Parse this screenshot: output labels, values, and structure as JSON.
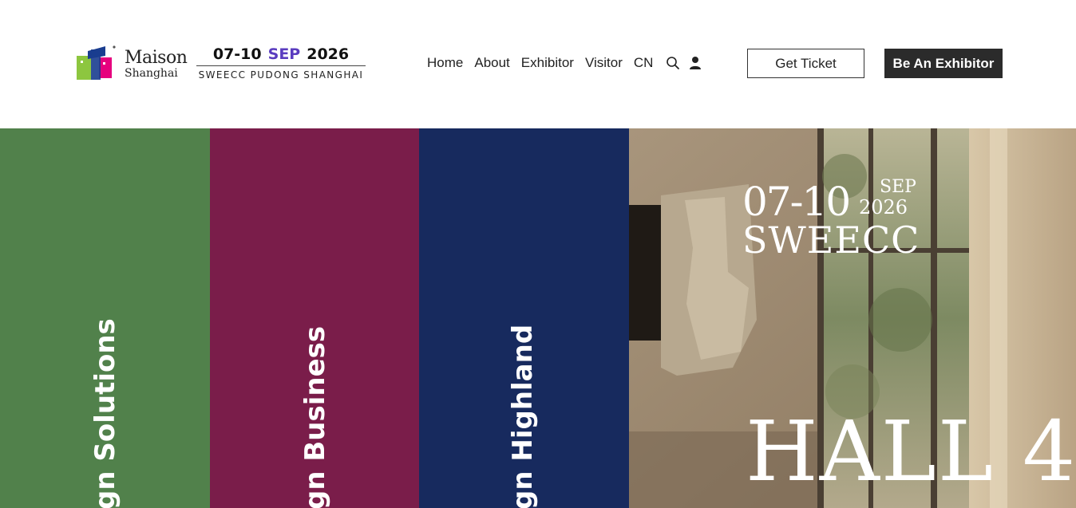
{
  "header": {
    "logo": {
      "word1": "Maison",
      "word2": "Shanghai",
      "colors": [
        "#8dc63f",
        "#e6007e",
        "#1a3d8f"
      ]
    },
    "event": {
      "days": "07-10",
      "month": "SEP",
      "year": "2026",
      "venue": "SWEECC PUDONG SHANGHAI",
      "month_color": "#5a3cbf"
    },
    "nav": {
      "items": [
        {
          "label": "Home"
        },
        {
          "label": "About"
        },
        {
          "label": "Exhibitor"
        },
        {
          "label": "Visitor"
        },
        {
          "label": "CN"
        }
      ],
      "icons": [
        "search-icon",
        "user-icon"
      ]
    },
    "buttons": {
      "ticket": "Get Ticket",
      "exhibitor": "Be An Exhibitor"
    }
  },
  "hero": {
    "panels": [
      {
        "label": "gn Solutions",
        "color": "#51814b"
      },
      {
        "label": "gn Business",
        "color": "#7a1d4a"
      },
      {
        "label": "gn Highland",
        "color": "#172a5e"
      }
    ],
    "photo": {
      "days": "07-10",
      "month": "SEP",
      "year": "2026",
      "venue": "SWEECC",
      "hall": "HALL 4"
    }
  }
}
